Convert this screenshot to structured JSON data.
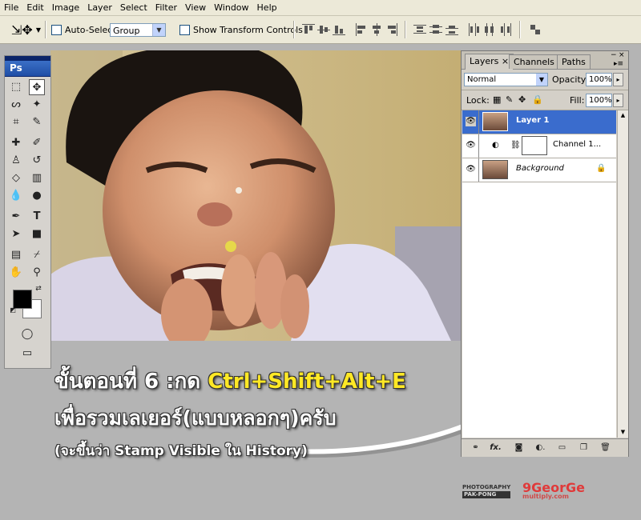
{
  "menu": [
    "File",
    "Edit",
    "Image",
    "Layer",
    "Select",
    "Filter",
    "View",
    "Window",
    "Help"
  ],
  "options": {
    "auto_select_label": "Auto-Select:",
    "auto_select_value": "Group",
    "show_transform_label": "Show Transform Controls"
  },
  "toolbox": {
    "logo": "Ps"
  },
  "layers_panel": {
    "tabs": [
      "Layers",
      "Channels",
      "Paths"
    ],
    "blend_mode": "Normal",
    "opacity_label": "Opacity:",
    "opacity_value": "100%",
    "lock_label": "Lock:",
    "fill_label": "Fill:",
    "fill_value": "100%",
    "layers": [
      {
        "name": "Layer 1",
        "selected": true
      },
      {
        "name": "Channel 1...",
        "selected": false
      },
      {
        "name": "Background",
        "selected": false
      }
    ]
  },
  "caption": {
    "line1_prefix": "ขั้นตอนที่ 6 :กด ",
    "line1_highlight": "Ctrl+Shift+Alt+E",
    "line2": "เพื่อรวมเลเยอร์(แบบหลอกๆ)ครับ",
    "line3": "(จะขึ้นว่า Stamp Visible ใน History)"
  },
  "watermark": {
    "left_lines": [
      "PHOTOGRAPHY",
      "PAK-PONG"
    ],
    "brand": "9GeorGe",
    "brand_sub": "multiply.com"
  },
  "colors": {
    "selected_layer": "#3a6ccd",
    "caption_highlight": "#ffe825"
  }
}
